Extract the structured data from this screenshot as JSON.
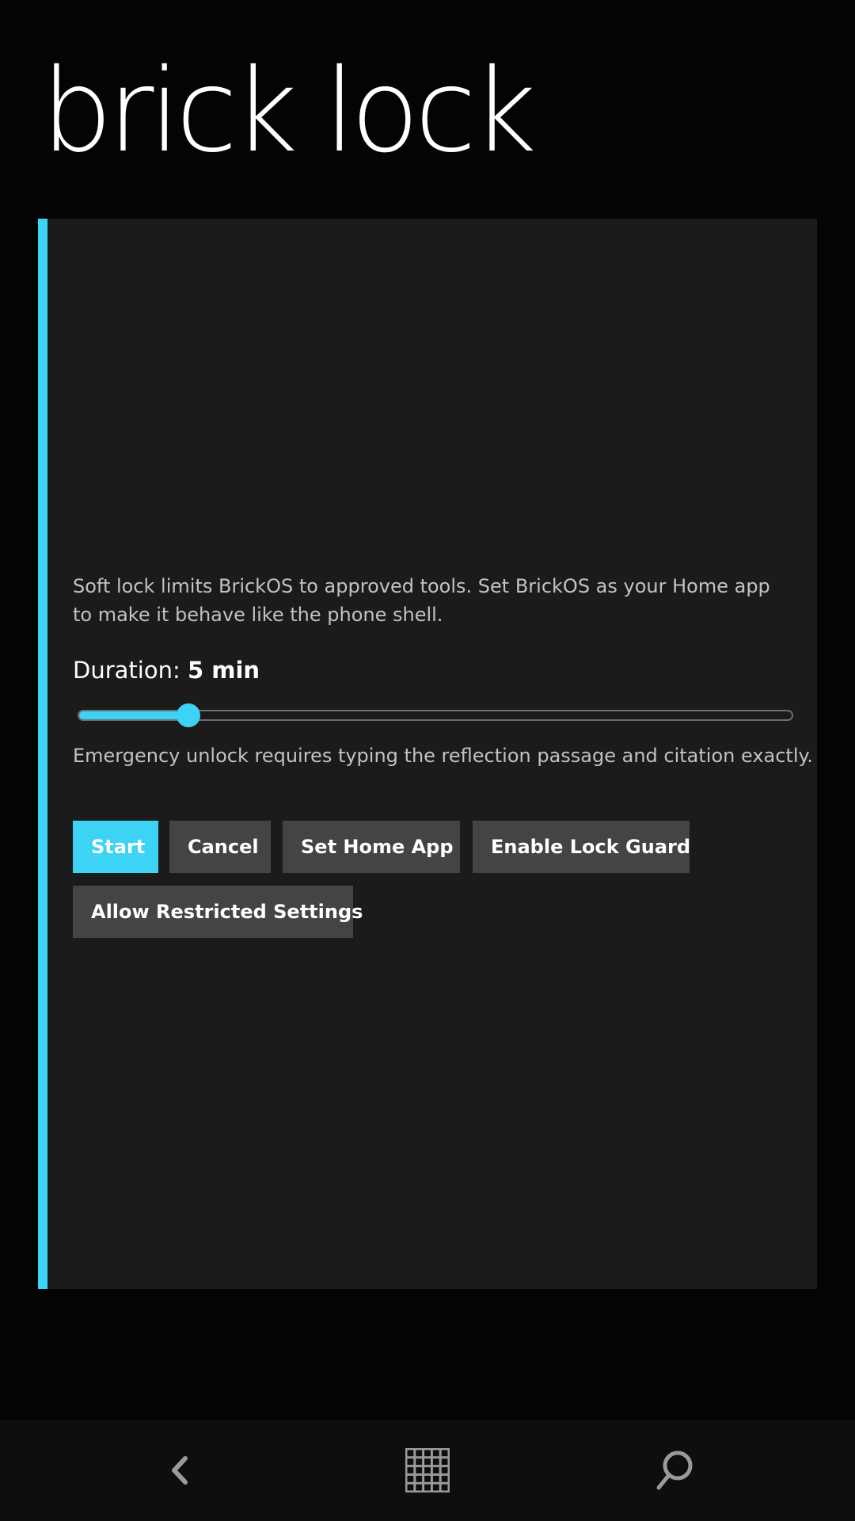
{
  "app": {
    "title": "brick lock"
  },
  "panel": {
    "description": "Soft lock limits BrickOS to approved tools. Set BrickOS as your Home app to make it behave like the phone shell.",
    "duration_label": "Duration:",
    "duration_value": "5 min",
    "slider": {
      "fraction": 0.155
    },
    "emergency_note": "Emergency unlock requires typing the reflection passage and citation exactly."
  },
  "buttons": {
    "start": "Start",
    "cancel": "Cancel",
    "set_home_app": "Set Home App",
    "enable_lock_guard": "Enable Lock Guard",
    "allow_restricted_settings": "Allow Restricted Settings"
  },
  "navbar": {
    "back_icon": "back-icon",
    "start_icon": "windows-grid-icon",
    "search_icon": "search-icon"
  },
  "colors": {
    "accent": "#3dd3f5",
    "background": "#040404",
    "panel": "#1b1b1b",
    "button": "#444444"
  }
}
